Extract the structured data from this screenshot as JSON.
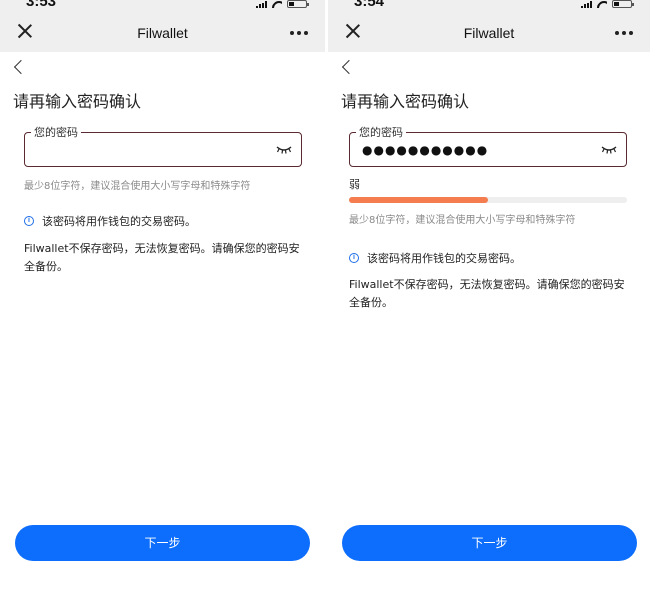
{
  "screens": [
    {
      "status": {
        "time": "3:53"
      },
      "nav": {
        "title": "Filwallet"
      },
      "heading": "请再输入密码确认",
      "field": {
        "legend": "您的密码",
        "value": ""
      },
      "hint": "最少8位字符，建议混合使用大小写字母和特殊字符",
      "info": "该密码将用作钱包的交易密码。",
      "note": "Filwallet不保存密码，无法恢复密码。请确保您的密码安全备份。",
      "button": "下一步"
    },
    {
      "status": {
        "time": "3:54"
      },
      "nav": {
        "title": "Filwallet"
      },
      "heading": "请再输入密码确认",
      "field": {
        "legend": "您的密码",
        "value": "●●●●●●●●●●●"
      },
      "strength": {
        "label": "弱",
        "fraction": 0.5
      },
      "hint": "最少8位字符，建议混合使用大小写字母和特殊字符",
      "info": "该密码将用作钱包的交易密码。",
      "note": "Filwallet不保存密码，无法恢复密码。请确保您的密码安全备份。",
      "button": "下一步"
    }
  ],
  "colors": {
    "primary": "#0d6efd",
    "strength_weak": "#f47c4f",
    "field_border": "#5a2a30",
    "header_bg": "#efefef"
  },
  "icons": [
    "close-icon",
    "more-icon",
    "back-chevron-icon",
    "eye-closed-icon",
    "info-icon",
    "signal-icon",
    "wifi-icon",
    "battery-icon"
  ]
}
